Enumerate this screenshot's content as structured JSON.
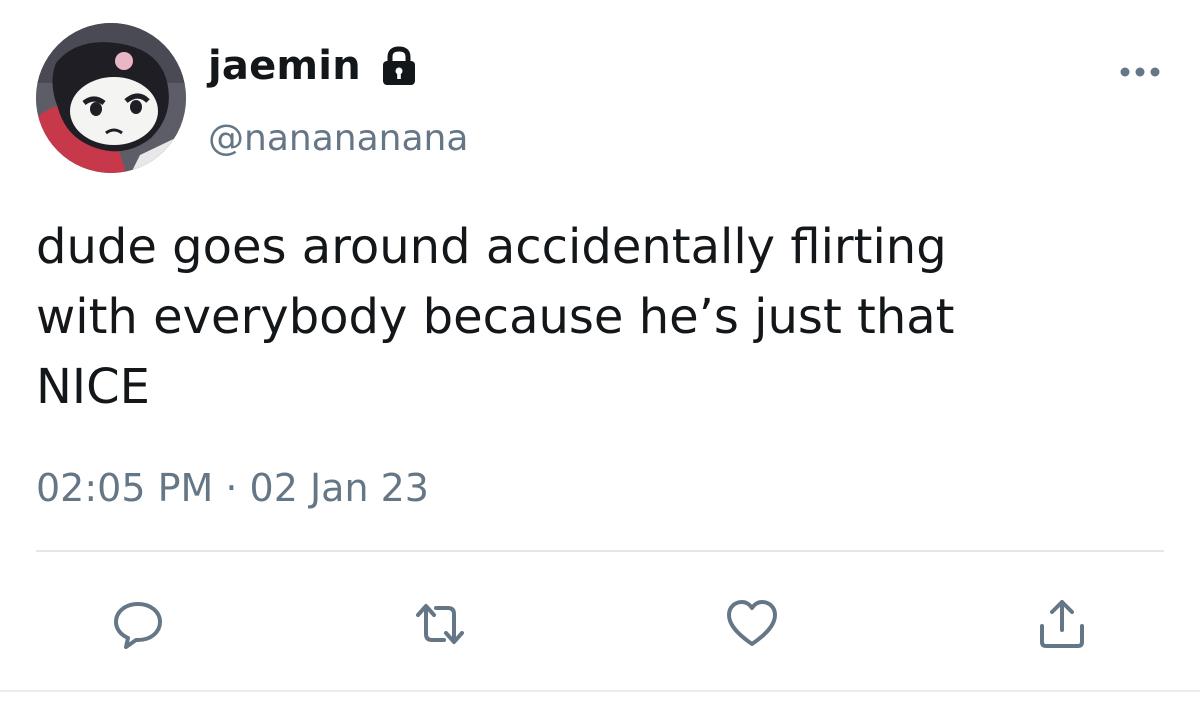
{
  "tweet": {
    "author": {
      "display_name": "jaemin",
      "handle": "@nanananana",
      "locked": true
    },
    "text": "dude goes around accidentally flirting\nwith everybody because he’s just that\nNICE",
    "timestamp": "02:05 PM · 02 Jan 23",
    "actions": {
      "reply_icon": "reply-icon",
      "retweet_icon": "retweet-icon",
      "like_icon": "heart-icon",
      "share_icon": "share-icon"
    }
  },
  "colors": {
    "text_primary": "#14171a",
    "text_secondary": "#657786",
    "divider": "#e1e8ed",
    "icon": "#657786"
  }
}
